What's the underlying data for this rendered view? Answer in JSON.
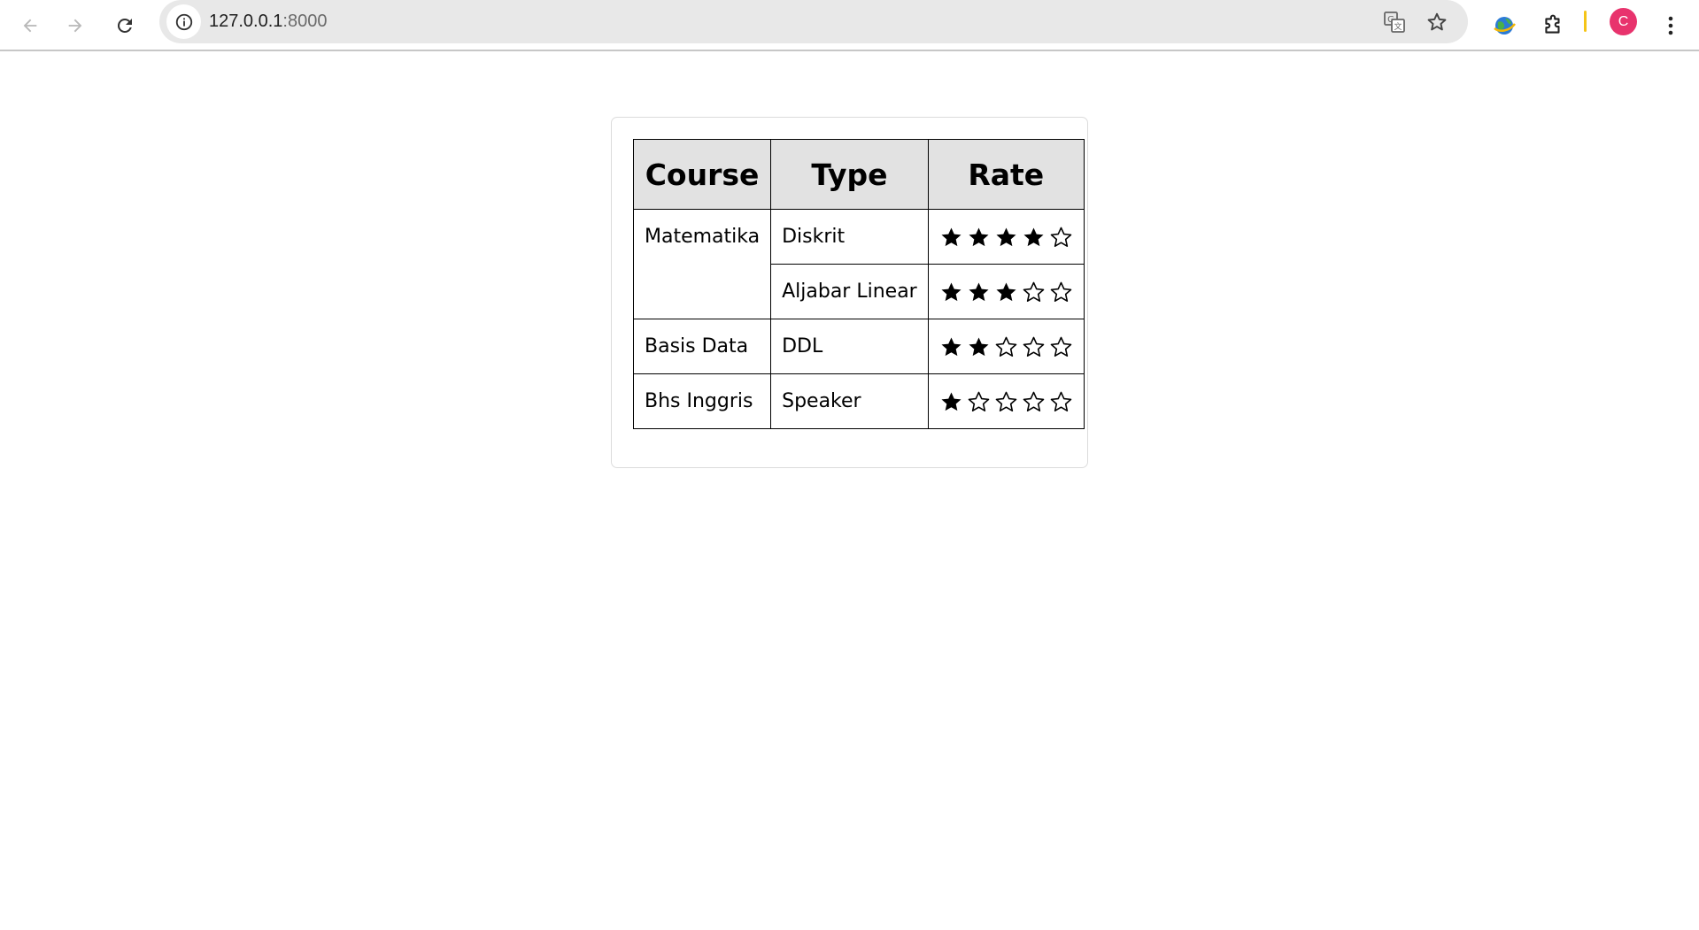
{
  "browser": {
    "url_host": "127.0.0.1",
    "url_port": ":8000",
    "profile_initial": "C"
  },
  "table": {
    "headers": {
      "course": "Course",
      "type": "Type",
      "rate": "Rate"
    },
    "rows": [
      {
        "course": "Matematika",
        "course_rowspan": 2,
        "type": "Diskrit",
        "rating": 4,
        "max_rating": 5
      },
      {
        "course": null,
        "type": "Aljabar Linear",
        "rating": 3,
        "max_rating": 5
      },
      {
        "course": "Basis Data",
        "course_rowspan": 1,
        "type": "DDL",
        "rating": 2,
        "max_rating": 5
      },
      {
        "course": "Bhs Inggris",
        "course_rowspan": 1,
        "type": "Speaker",
        "rating": 1,
        "max_rating": 5
      }
    ]
  },
  "colors": {
    "header_bg": "#e2e2e2",
    "avatar_bg": "#e8336d",
    "omnibox_bg": "#e8e8e8"
  }
}
